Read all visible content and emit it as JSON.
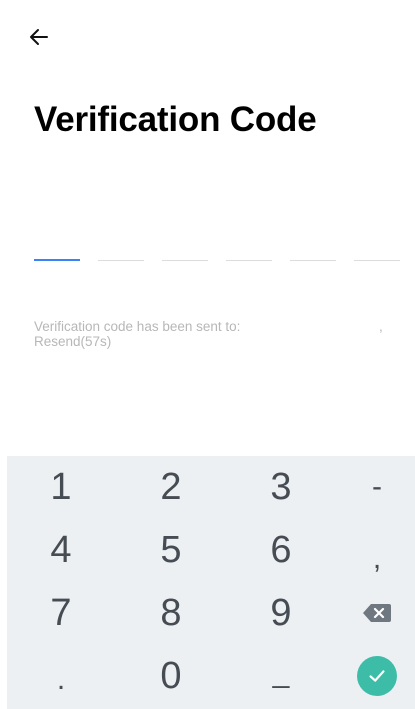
{
  "header": {
    "back_icon": "arrow-left-icon"
  },
  "title": "Verification Code",
  "code": {
    "length": 6,
    "digits": [
      "",
      "",
      "",
      "",
      "",
      ""
    ],
    "active_index": 0,
    "active_color": "#3b82f6"
  },
  "info": {
    "sent_text": "Verification code has been sent to:",
    "masked_contact": ",",
    "resend_text": "Resend(57s)",
    "color": "#b7b7b7"
  },
  "keyboard": {
    "background": "#edf0f3",
    "rows": [
      [
        "1",
        "2",
        "3",
        "-"
      ],
      [
        "4",
        "5",
        "6",
        ","
      ],
      [
        "7",
        "8",
        "9",
        "delete"
      ],
      [
        ".",
        "0",
        "_",
        "confirm"
      ]
    ],
    "delete_icon": "backspace-icon",
    "confirm_icon": "check-icon",
    "confirm_color": "#3dbda8"
  }
}
